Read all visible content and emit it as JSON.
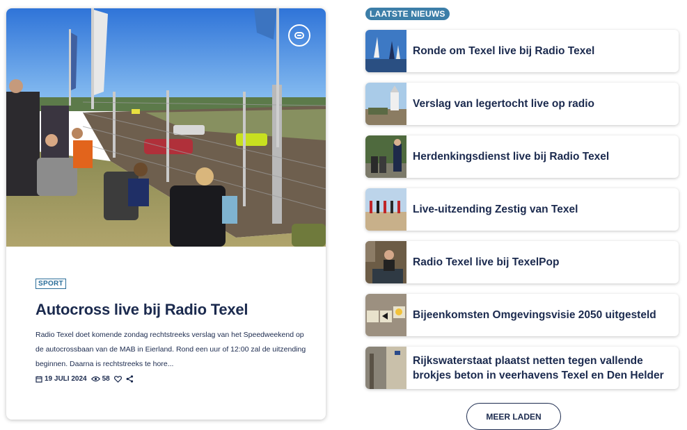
{
  "feature": {
    "image_alt": "Autocross spectators by the fence",
    "category": "SPORT",
    "title": "Autocross live bij Radio Texel",
    "excerpt": "Radio Texel doet komende zondag rechtstreeks verslag van het Speedweekend op de autocrossbaan van de MAB in Eierland. Rond een uur of 12:00 zal de uitzending beginnen. Daarna is rechtstreeks te hore...",
    "date": "19 JULI 2024",
    "views": "58"
  },
  "news": {
    "section_label": "LAATSTE NIEUWS",
    "items": [
      {
        "title": "Ronde om Texel live bij Radio Texel"
      },
      {
        "title": "Verslag van legertocht live op radio"
      },
      {
        "title": "Herdenkingsdienst live bij Radio Texel"
      },
      {
        "title": "Live-uitzending Zestig van Texel"
      },
      {
        "title": "Radio Texel live bij TexelPop"
      },
      {
        "title": "Bijeenkomsten Omgevingsvisie 2050 uitgesteld"
      },
      {
        "title": "Rijkswaterstaat plaatst netten tegen vallende brokjes beton in veerhavens Texel en Den Helder"
      }
    ],
    "more_label": "MEER LADEN"
  },
  "colors": {
    "navy": "#1b2a4e",
    "accent": "#3c7ea8"
  },
  "icons": {
    "link": "link-icon",
    "date": "calendar-icon",
    "views": "eye-icon",
    "like": "heart-icon",
    "share": "share-icon"
  }
}
